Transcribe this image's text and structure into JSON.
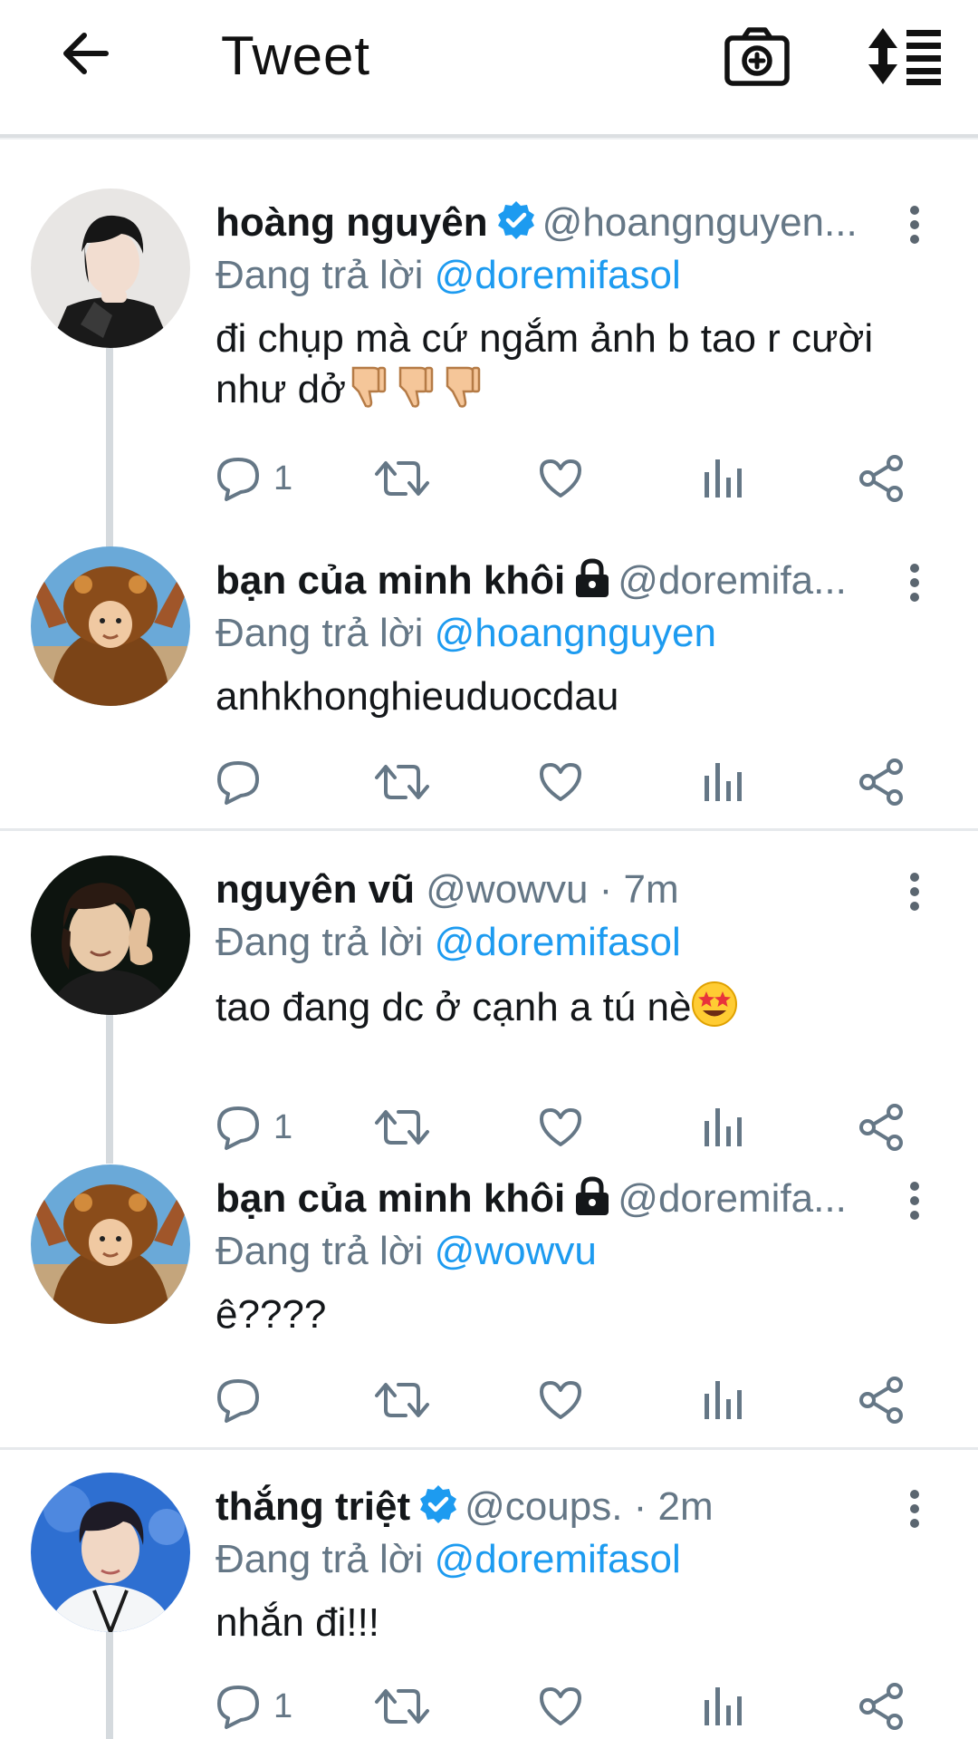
{
  "header": {
    "title": "Tweet",
    "back_icon": "arrow-left-icon",
    "camera_icon": "camera-plus-icon",
    "sort_icon": "sort-list-icon"
  },
  "colors": {
    "accent": "#1d9bf0",
    "text": "#14171a",
    "muted": "#657786",
    "divider": "#e6e9ec",
    "thread_line": "#d5dade"
  },
  "tweets": [
    {
      "name": "hoàng nguyên",
      "verified": true,
      "locked": false,
      "handle": "@hoangnguyen...",
      "meta": "",
      "reply_prefix": "Đang trả lời",
      "reply_to": "@doremifasol",
      "text": "đi chụp mà cứ ngắm ảnh b tao r cười như dở",
      "emojis": "👎👎👎",
      "reply_count": "1"
    },
    {
      "name": "bạn của minh khôi",
      "verified": false,
      "locked": true,
      "handle": "@doremifa...",
      "meta": "",
      "reply_prefix": "Đang trả lời",
      "reply_to": "@hoangnguyen",
      "text": "anhkhonghieuduocdau",
      "emojis": "",
      "reply_count": ""
    },
    {
      "name": "nguyên vũ",
      "verified": false,
      "locked": false,
      "handle": "@wowvu",
      "meta": " · 7m",
      "reply_prefix": "Đang trả lời",
      "reply_to": "@doremifasol",
      "text": "tao đang dc ở cạnh a tú nè",
      "emojis": "🤩",
      "reply_count": "1"
    },
    {
      "name": "bạn của minh khôi",
      "verified": false,
      "locked": true,
      "handle": "@doremifa...",
      "meta": "",
      "reply_prefix": "Đang trả lời",
      "reply_to": "@wowvu",
      "text": "ê????",
      "emojis": "",
      "reply_count": ""
    },
    {
      "name": "thắng triệt",
      "verified": true,
      "locked": false,
      "handle": "@coups.",
      "meta": " · 2m",
      "reply_prefix": "Đang trả lời",
      "reply_to": "@doremifasol",
      "text": "nhắn đi!!!",
      "emojis": "",
      "reply_count": "1"
    }
  ]
}
